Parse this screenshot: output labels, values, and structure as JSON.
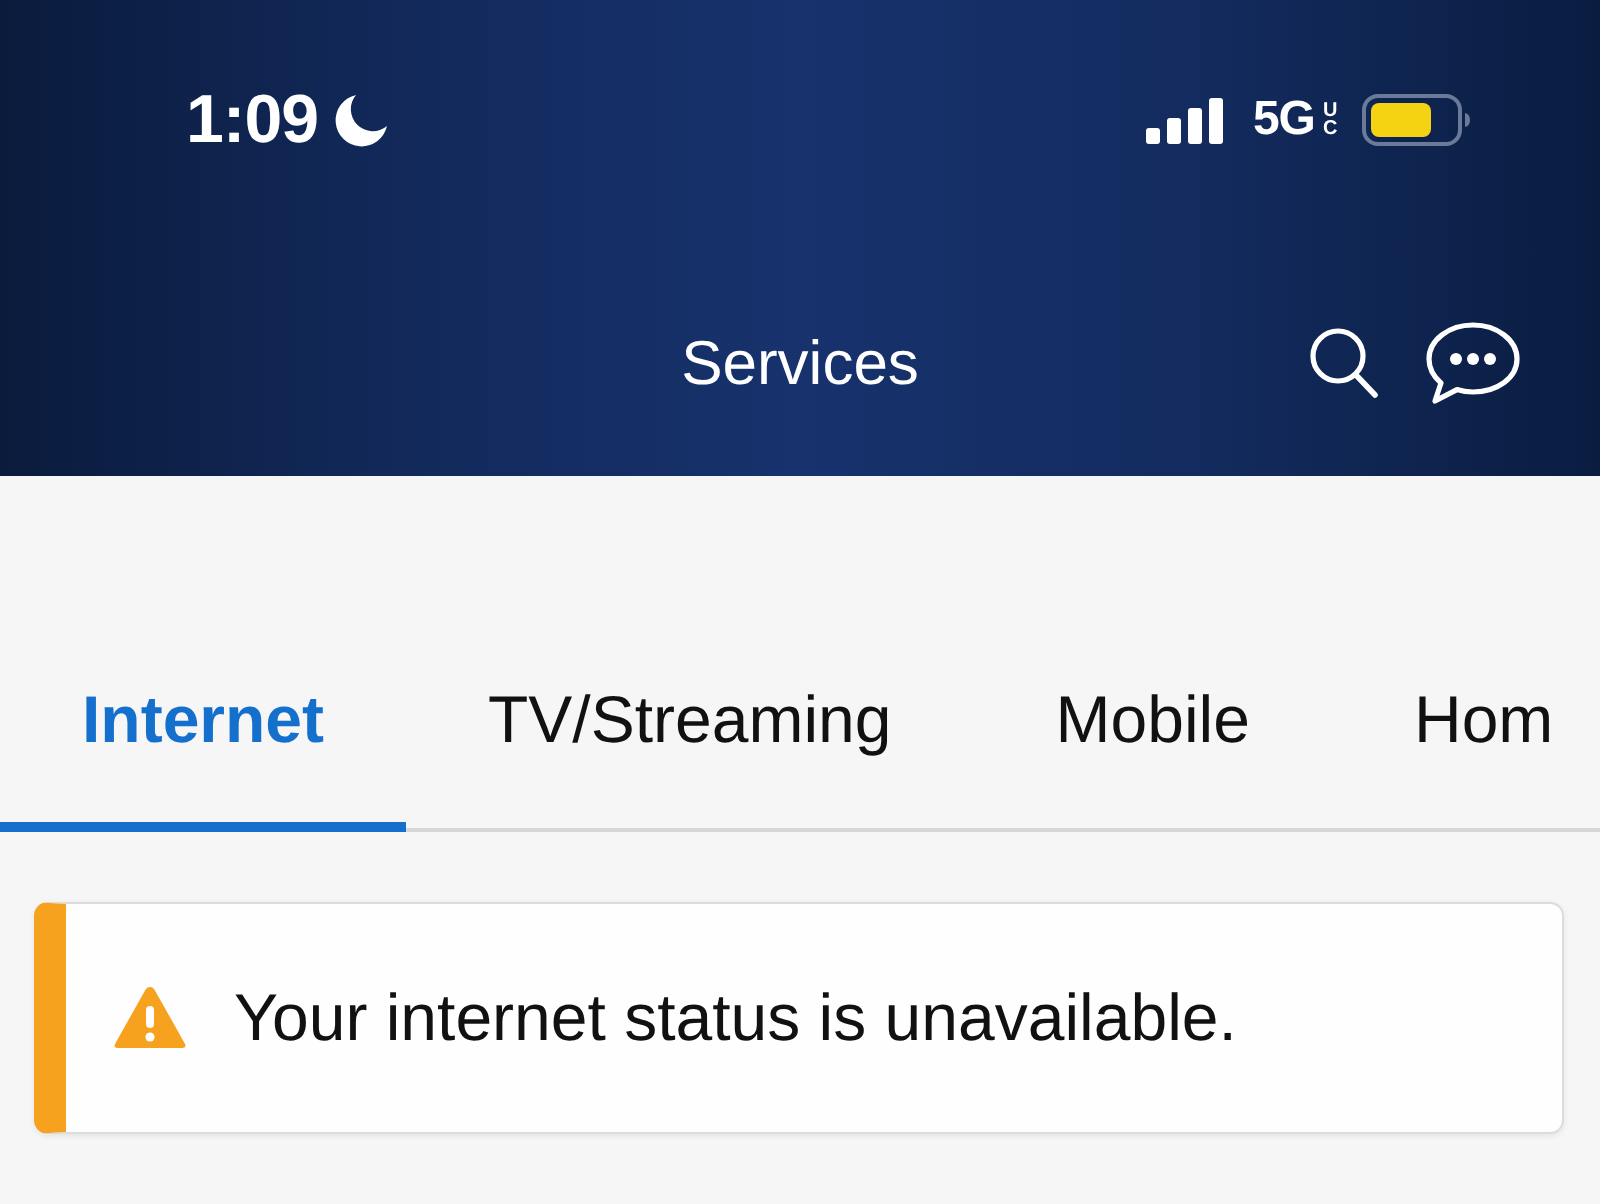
{
  "status_bar": {
    "time": "1:09",
    "network": "5G",
    "network_suffix": "UC"
  },
  "header": {
    "title": "Services"
  },
  "tabs": [
    {
      "label": "Internet",
      "selected": true
    },
    {
      "label": "TV/Streaming",
      "selected": false
    },
    {
      "label": "Mobile",
      "selected": false
    },
    {
      "label": "Hom",
      "selected": false
    }
  ],
  "alert": {
    "kind": "warning",
    "message": "Your internet status is unavailable."
  }
}
